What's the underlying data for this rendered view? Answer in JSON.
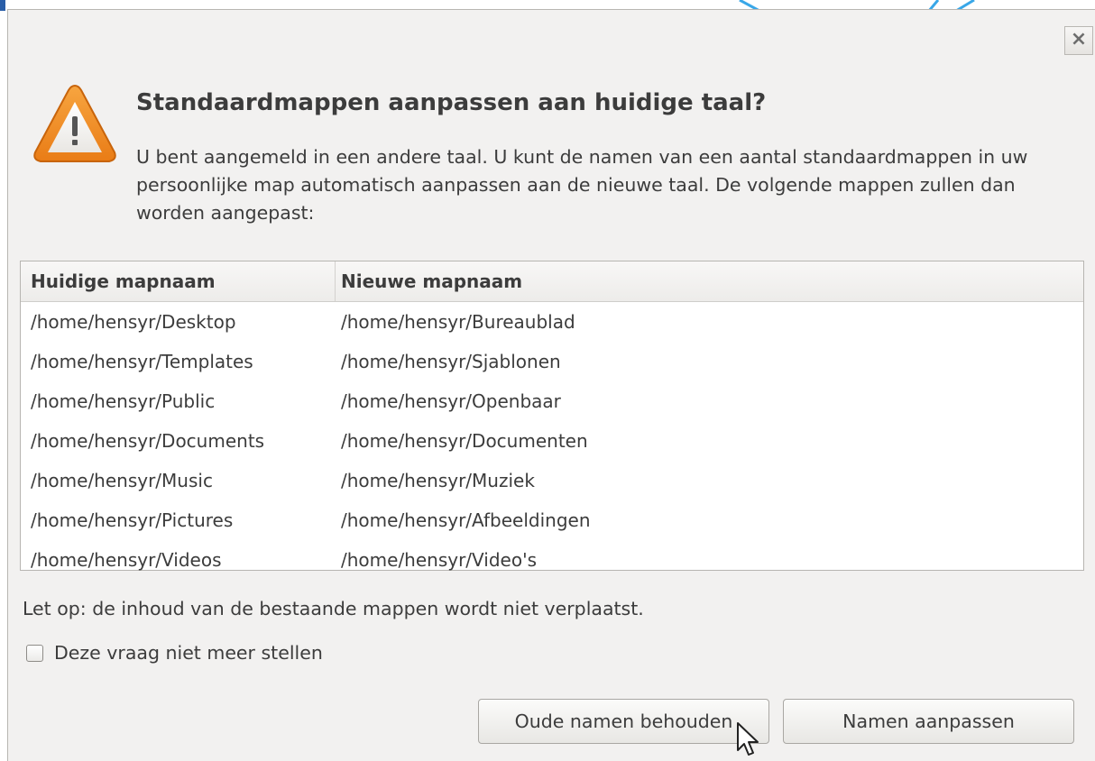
{
  "dialog": {
    "title": "Standaardmappen aanpassen aan huidige taal?",
    "description": "U bent aangemeld in een andere taal. U kunt de namen van een aantal standaardmappen in uw persoonlijke map automatisch aanpassen aan de nieuwe taal. De volgende mappen zullen dan worden aangepast:",
    "close_label": "×"
  },
  "table": {
    "headers": [
      "Huidige mapnaam",
      "Nieuwe mapnaam"
    ],
    "rows": [
      [
        "/home/hensyr/Desktop",
        "/home/hensyr/Bureaublad"
      ],
      [
        "/home/hensyr/Templates",
        "/home/hensyr/Sjablonen"
      ],
      [
        "/home/hensyr/Public",
        "/home/hensyr/Openbaar"
      ],
      [
        "/home/hensyr/Documents",
        "/home/hensyr/Documenten"
      ],
      [
        "/home/hensyr/Music",
        "/home/hensyr/Muziek"
      ],
      [
        "/home/hensyr/Pictures",
        "/home/hensyr/Afbeeldingen"
      ],
      [
        "/home/hensyr/Videos",
        "/home/hensyr/Video's"
      ]
    ]
  },
  "note": "Let op: de inhoud van de bestaande mappen wordt niet verplaatst.",
  "checkbox": {
    "label": "Deze vraag niet meer stellen",
    "checked": false
  },
  "buttons": {
    "keep": "Oude namen behouden",
    "rename": "Namen aanpassen"
  },
  "icons": {
    "warning": "warning-triangle-icon",
    "close": "close-icon",
    "cursor": "mouse-pointer-icon"
  },
  "colors": {
    "dialog_bg": "#f2f1f0",
    "warning_orange": "#f08a1d",
    "text": "#3c3c3c"
  }
}
